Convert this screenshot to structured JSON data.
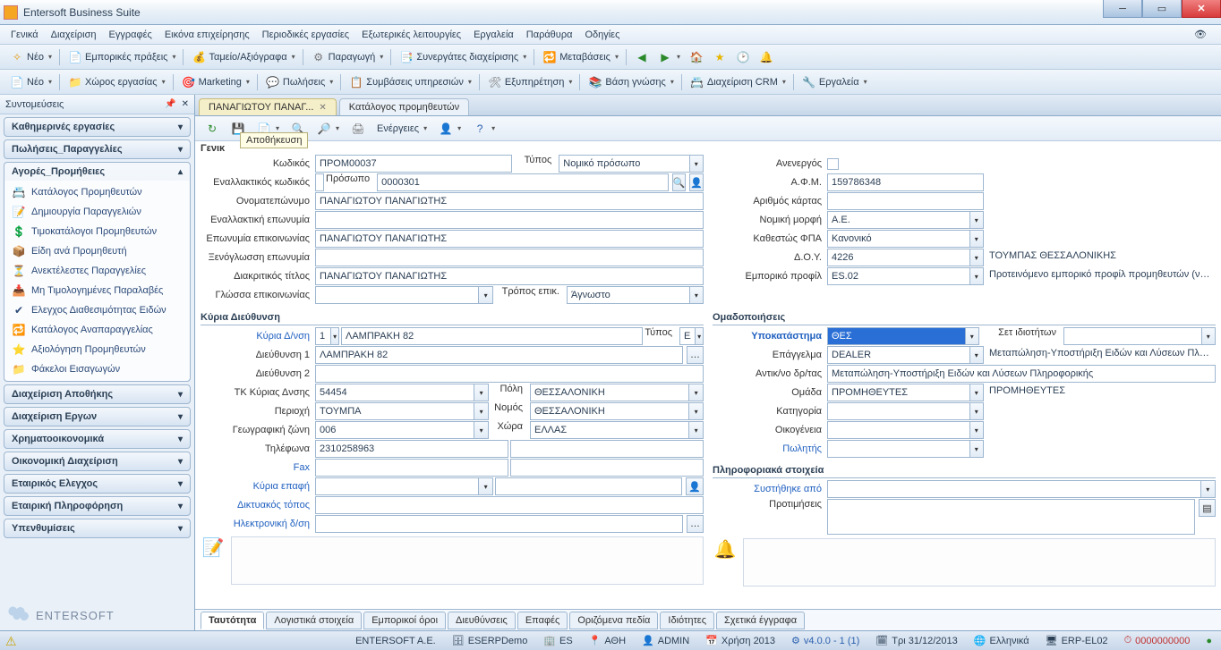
{
  "window": {
    "title": "Entersoft Business Suite"
  },
  "menu": [
    "Γενικά",
    "Διαχείριση",
    "Εγγραφές",
    "Εικόνα επιχείρησης",
    "Περιοδικές εργασίες",
    "Εξωτερικές λειτουργίες",
    "Εργαλεία",
    "Παράθυρα",
    "Οδηγίες"
  ],
  "toolbar1": {
    "neo": "Νέο",
    "items": [
      "Εμπορικές πράξεις",
      "Ταμείο/Αξιόγραφα",
      "Παραγωγή",
      "Συνεργάτες διαχείρισης",
      "Μεταβάσεις"
    ]
  },
  "toolbar2": {
    "neo": "Νέο",
    "items": [
      "Χώρος εργασίας",
      "Marketing",
      "Πωλήσεις",
      "Συμβάσεις υπηρεσιών",
      "Εξυπηρέτηση",
      "Βάση γνώσης",
      "Διαχείριση CRM",
      "Εργαλεία"
    ]
  },
  "sidebar": {
    "title": "Συντομεύσεις",
    "groups": [
      {
        "label": "Καθημερινές εργασίες",
        "open": false
      },
      {
        "label": "Πωλήσεις_Παραγγελίες",
        "open": false
      },
      {
        "label": "Αγορές_Προμήθειες",
        "open": true,
        "items": [
          "Κατάλογος Προμηθευτών",
          "Δημιουργία Παραγγελιών",
          "Τιμοκατάλογοι Προμηθευτών",
          "Είδη ανά Προμηθευτή",
          "Ανεκτέλεστες Παραγγελίες",
          "Μη Τιμολογημένες Παραλαβές",
          "Ελεγχος Διαθεσιμότητας Ειδών",
          "Κατάλογος Αναπαραγγελίας",
          "Αξιολόγηση Προμηθευτών",
          "Φάκελοι Εισαγωγών"
        ]
      },
      {
        "label": "Διαχείριση Αποθήκης",
        "open": false
      },
      {
        "label": "Διαχείριση Εργων",
        "open": false
      },
      {
        "label": "Χρηματοοικονομικά",
        "open": false
      },
      {
        "label": "Οικονομική Διαχείριση",
        "open": false
      },
      {
        "label": "Εταιρικός Ελεγχος",
        "open": false
      },
      {
        "label": "Εταιρική Πληροφόρηση",
        "open": false
      },
      {
        "label": "Υπενθυμίσεις",
        "open": false
      }
    ],
    "brand": "ENTERSOFT"
  },
  "tabs": [
    {
      "label": "ΠΑΝΑΓΙΩΤΟΥ ΠΑΝΑΓ...",
      "active": true
    },
    {
      "label": "Κατάλογος προμηθευτών",
      "active": false
    }
  ],
  "docToolbar": {
    "actions": "Ενέργειες",
    "tooltip": "Αποθήκευση"
  },
  "form": {
    "general": "Γενικ",
    "left": {
      "code_l": "Κωδικός",
      "code_v": "ΠΡΟΜ00037",
      "type_l": "Τύπος",
      "type_v": "Νομικό πρόσωπο",
      "altcode_l": "Εναλλακτικός κωδικός",
      "prosopo_l": "Πρόσωπο",
      "prosopo_v": "0000301",
      "fullname_l": "Ονοματεπώνυμο",
      "fullname_v": "ΠΑΝΑΓΙΩΤΟΥ ΠΑΝΑΓΙΩΤΗΣ",
      "altname_l": "Εναλλακτική επωνυμία",
      "contactname_l": "Επωνυμία επικοινωνίας",
      "contactname_v": "ΠΑΝΑΓΙΩΤΟΥ ΠΑΝΑΓΙΩΤΗΣ",
      "foreign_l": "Ξενόγλωσση επωνυμία",
      "distin_l": "Διακριτικός τίτλος",
      "distin_v": "ΠΑΝΑΓΙΩΤΟΥ ΠΑΝΑΓΙΩΤΗΣ",
      "lang_l": "Γλώσσα επικοινωνίας",
      "comm_l": "Τρόπος επικ.",
      "comm_v": "Άγνωστο"
    },
    "right": {
      "inactive_l": "Ανενεργός",
      "afm_l": "Α.Φ.Μ.",
      "afm_v": "159786348",
      "card_l": "Αριθμός κάρτας",
      "legal_l": "Νομική μορφή",
      "legal_v": "Α.Ε.",
      "vat_l": "Καθεστώς ΦΠΑ",
      "vat_v": "Κανονικό",
      "doy_l": "Δ.Ο.Υ.",
      "doy_v": "4226",
      "doy_desc": "ΤΟΥΜΠΑΣ ΘΕΣΣΑΛΟΝΙΚΗΣ",
      "profile_l": "Εμπορικό προφίλ",
      "profile_v": "ES.02",
      "profile_desc": "Προτεινόμενο εμπορικό προφίλ προμηθευτών (νομικά"
    },
    "addr_section": "Κύρια Διεύθυνση",
    "addr": {
      "main_l": "Κύρια Δ/νση",
      "main_no": "1",
      "main_v": "ΛΑΜΠΡΑΚΗ 82",
      "main_type_l": "Τύπος",
      "main_type_v": "ΕΔΡΑ",
      "addr1_l": "Διεύθυνση 1",
      "addr1_v": "ΛΑΜΠΡΑΚΗ 82",
      "addr2_l": "Διεύθυνση 2",
      "zip_l": "ΤΚ Κύριας Δνσης",
      "zip_v": "54454",
      "city_l": "Πόλη",
      "city_v": "ΘΕΣΣΑΛΟΝΙΚΗ",
      "area_l": "Περιοχή",
      "area_v": "ΤΟΥΜΠΑ",
      "nomos_l": "Νομός",
      "nomos_v": "ΘΕΣΣΑΛΟΝΙΚΗ",
      "geo_l": "Γεωγραφική ζώνη",
      "geo_v": "006",
      "country_l": "Χώρα",
      "country_v": "ΕΛΛΑΣ",
      "phone_l": "Τηλέφωνα",
      "phone_v": "2310258963",
      "fax_l": "Fax",
      "contact_l": "Κύρια επαφή",
      "web_l": "Δικτυακός τόπος",
      "email_l": "Ηλεκτρονική δ/ση"
    },
    "group_section": "Ομαδοποιήσεις",
    "group": {
      "branch_l": "Υποκατάστημα",
      "branch_v": "ΘΕΣ",
      "set_l": "Σετ ιδιοτήτων",
      "prof_l": "Επάγγελμα",
      "prof_v": "DEALER",
      "prof_desc": "Μεταπώληση-Υποστήριξη Ειδών και Λύσεων Πληροφο",
      "act_l": "Αντικ/νο δρ/τας",
      "act_v": "Μεταπώληση-Υποστήριξη Ειδών και Λύσεων Πληροφορικής",
      "grp_l": "Ομάδα",
      "grp_v": "ΠΡΟΜΗΘΕΥΤΕΣ",
      "grp_desc": "ΠΡΟΜΗΘΕΥΤΕΣ",
      "cat_l": "Κατηγορία",
      "fam_l": "Οικογένεια",
      "seller_l": "Πωλητής"
    },
    "info_section": "Πληροφοριακά στοιχεία",
    "info": {
      "rec_l": "Συστήθηκε από",
      "pref_l": "Προτιμήσεις"
    }
  },
  "bottomTabs": [
    "Ταυτότητα",
    "Λογιστικά στοιχεία",
    "Εμπορικοί όροι",
    "Διευθύνσεις",
    "Επαφές",
    "Οριζόμενα πεδία",
    "Ιδιότητες",
    "Σχετικά έγγραφα"
  ],
  "status": {
    "company": "ENTERSOFT A.E.",
    "db": "ESERPDemo",
    "es": "ES",
    "ath": "ΑΘΗ",
    "admin": "ADMIN",
    "use": "Χρήση 2013",
    "ver": "v4.0.0 - 1 (1)",
    "date": "Τρι 31/12/2013",
    "lang": "Ελληνικά",
    "erp": "ERP-EL02",
    "counter": "0000000000"
  }
}
